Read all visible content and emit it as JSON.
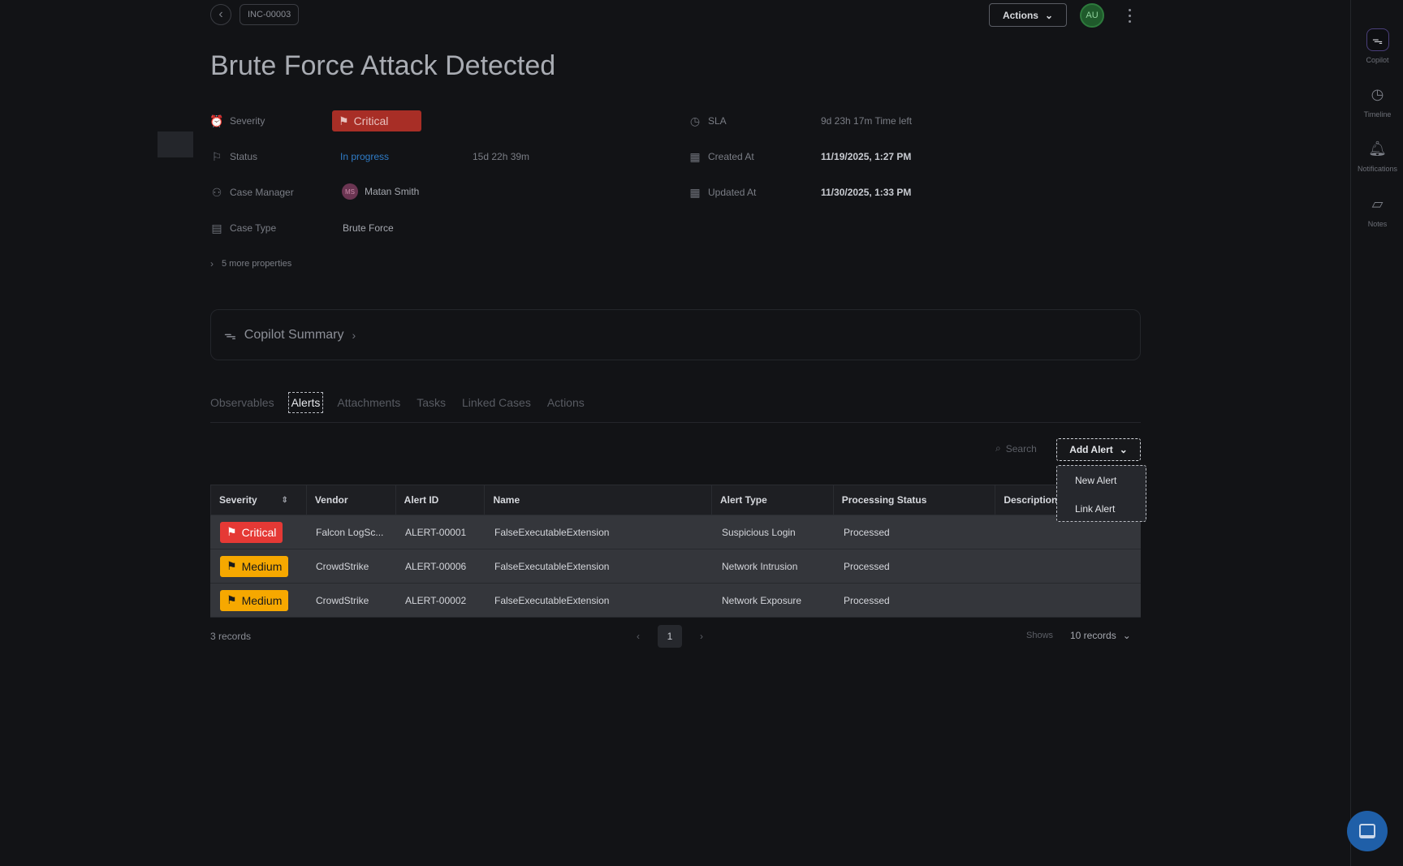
{
  "header": {
    "back_icon": "chevron-left-icon",
    "case_id": "INC-00003",
    "actions_label": "Actions",
    "user_initials": "AU"
  },
  "case": {
    "title": "Brute Force Attack Detected",
    "severity_label": "Severity",
    "severity_value": "Critical",
    "status_label": "Status",
    "status_value": "In progress",
    "status_duration": "15d 22h 39m",
    "manager_label": "Case Manager",
    "manager_initials": "MS",
    "manager_name": "Matan Smith",
    "type_label": "Case Type",
    "type_value": "Brute Force",
    "more_properties": "5 more properties",
    "sla_label": "SLA",
    "sla_value": "9d 23h 17m  Time left",
    "created_label": "Created At",
    "created_value": "11/19/2025, 1:27 PM",
    "updated_label": "Updated At",
    "updated_value": "11/30/2025, 1:33 PM"
  },
  "copilot_summary": {
    "label": "Copilot Summary"
  },
  "tabs": [
    "Observables",
    "Alerts",
    "Attachments",
    "Tasks",
    "Linked Cases",
    "Actions"
  ],
  "toolbar": {
    "search_placeholder": "Search",
    "add_alert_label": "Add Alert",
    "dropdown": [
      "New Alert",
      "Link Alert"
    ]
  },
  "table": {
    "columns": [
      "Severity",
      "Vendor",
      "Alert ID",
      "Name",
      "Alert Type",
      "Processing Status",
      "Description"
    ],
    "rows": [
      {
        "severity": "Critical",
        "vendor": "Falcon LogSc...",
        "alert_id": "ALERT-00001",
        "name": "FalseExecutableExtension",
        "alert_type": "Suspicious Login",
        "status": "Processed",
        "description": ""
      },
      {
        "severity": "Medium",
        "vendor": "CrowdStrike",
        "alert_id": "ALERT-00006",
        "name": "FalseExecutableExtension",
        "alert_type": "Network Intrusion",
        "status": "Processed",
        "description": ""
      },
      {
        "severity": "Medium",
        "vendor": "CrowdStrike",
        "alert_id": "ALERT-00002",
        "name": "FalseExecutableExtension",
        "alert_type": "Network Exposure",
        "status": "Processed",
        "description": ""
      }
    ]
  },
  "footer": {
    "records": "3 records",
    "page": "1",
    "shows_label": "Shows",
    "per_page": "10 records"
  },
  "sidebar": {
    "copilot": "Copilot",
    "timeline": "Timeline",
    "notifications": "Notifications",
    "notes": "Notes"
  },
  "colors": {
    "critical": "#e53935",
    "medium": "#f6a800",
    "link": "#2f7cc7",
    "chat": "#1f5fa8"
  }
}
